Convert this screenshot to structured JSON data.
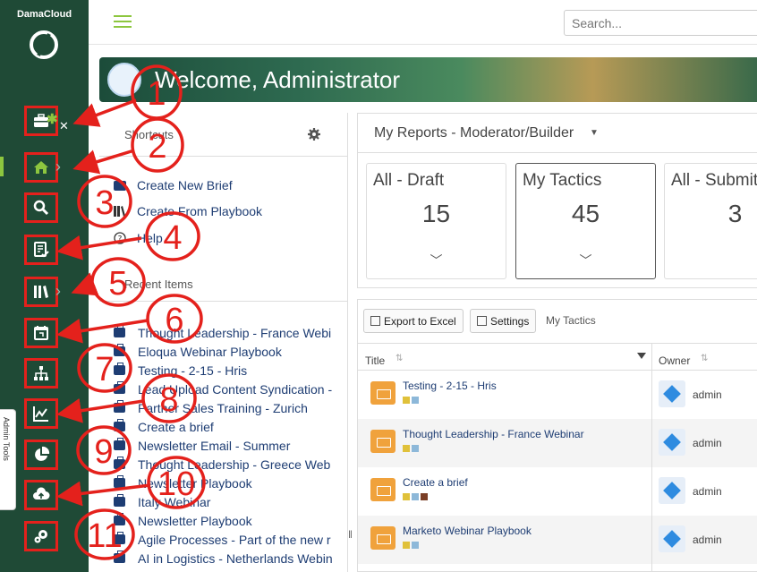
{
  "app": {
    "brand": "DamaCloud"
  },
  "sidebar": {
    "admin_tools_label": "Admin Tools"
  },
  "search": {
    "placeholder": "Search..."
  },
  "banner": {
    "title": "Welcome, Administrator"
  },
  "shortcuts": {
    "heading": "Shortcuts",
    "items": [
      {
        "label": "Create New Brief",
        "icon": "brief-icon"
      },
      {
        "label": "Create From Playbook",
        "icon": "library-icon"
      },
      {
        "label": "Help",
        "icon": "help-icon"
      }
    ]
  },
  "recent": {
    "heading": "Recent Items",
    "items": [
      "Thought Leadership - France Webi",
      "Eloqua Webinar Playbook",
      "Testing - 2-15 - Hris",
      "Lead Upload Content Syndication -",
      "Partner Sales Training - Zurich",
      "Create a brief",
      "Newsletter Email - Summer",
      "Thought Leadership - Greece Web",
      "Newsletter Playbook",
      "Italy Webinar",
      "Newsletter Playbook",
      "Agile Processes - Part of the new r",
      "AI in Logistics - Netherlands Webin"
    ]
  },
  "reports": {
    "title": "My Reports - Moderator/Builder",
    "cards": [
      {
        "label": "All - Draft",
        "value": "15"
      },
      {
        "label": "My Tactics",
        "value": "45"
      },
      {
        "label": "All - Submit",
        "value": "3"
      }
    ]
  },
  "grid": {
    "export_label": "Export to Excel",
    "settings_label": "Settings",
    "view_label": "My Tactics",
    "col_title": "Title",
    "col_owner": "Owner",
    "rows": [
      {
        "title": "Testing - 2-15 - Hris",
        "owner": "admin"
      },
      {
        "title": "Thought Leadership - France Webinar",
        "owner": "admin"
      },
      {
        "title": "Create a brief",
        "owner": "admin"
      },
      {
        "title": "Marketo Webinar Playbook",
        "owner": "admin"
      }
    ]
  },
  "annotations": [
    "1",
    "2",
    "3",
    "4",
    "5",
    "6",
    "7",
    "8",
    "9",
    "10",
    "11"
  ],
  "colors": {
    "sidebar": "#1f4a36",
    "accent": "#8dc63f",
    "annotation": "#e4211c",
    "link": "#1e3d73",
    "tactic": "#f0a23c"
  }
}
